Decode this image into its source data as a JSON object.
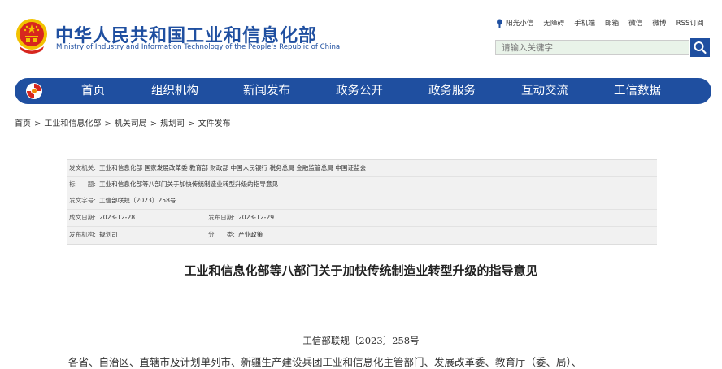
{
  "header": {
    "title": "中华人民共和国工业和信息化部",
    "subtitle": "Ministry of Industry and Information Technology of the People's Republic of China",
    "emblem_icon": "national-emblem-icon"
  },
  "toplinks": [
    "阳光小信",
    "无障碍",
    "手机端",
    "邮箱",
    "微信",
    "微博",
    "RSS订阅"
  ],
  "search": {
    "placeholder": "请输入关键字",
    "icon": "search-icon"
  },
  "nav": {
    "logo_icon": "miit-logo-icon",
    "items": [
      "首页",
      "组织机构",
      "新闻发布",
      "政务公开",
      "政务服务",
      "互动交流",
      "工信数据"
    ]
  },
  "breadcrumb": {
    "items": [
      "首页",
      "工业和信息化部",
      "机关司局",
      "规划司",
      "文件发布"
    ],
    "separator": ">"
  },
  "meta": {
    "issuers_label": "发文机关:",
    "issuers": "工业和信息化部 国家发展改革委 教育部 财政部 中国人民银行 税务总局 金融监管总局 中国证监会",
    "title_label": "标　　题:",
    "title": "工业和信息化部等八部门关于加快传统制造业转型升级的指导意见",
    "doc_no_label": "发文字号:",
    "doc_no": "工信部联规〔2023〕258号",
    "created_label": "成文日期:",
    "created": "2023-12-28",
    "published_label": "发布日期:",
    "published": "2023-12-29",
    "org_label": "发布机构:",
    "org": "规划司",
    "category_label": "分　　类:",
    "category": "产业政策"
  },
  "document": {
    "title": "工业和信息化部等八部门关于加快传统制造业转型升级的指导意见",
    "number": "工信部联规〔2023〕258号",
    "salutation": "各省、自治区、直辖市及计划单列市、新疆生产建设兵团工业和信息化主管部门、发展改革委、教育厅（委、局）、"
  },
  "colors": {
    "brand_blue": "#1f4fa0",
    "emblem_red": "#d7261e",
    "gold": "#f2c200",
    "search_bg": "#e9f3e9",
    "meta_bg": "#f1f1f1"
  }
}
